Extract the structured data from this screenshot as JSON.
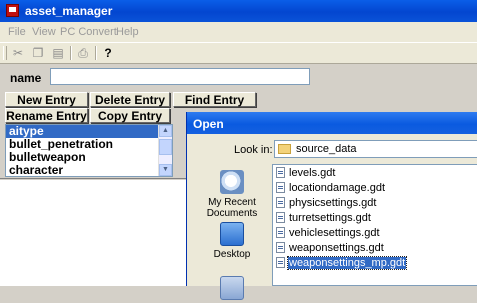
{
  "window": {
    "title": "asset_manager"
  },
  "menu": [
    "File",
    "View",
    "PC Convert",
    "Help"
  ],
  "toolbar": {
    "icons": [
      "cut-icon",
      "copy-icon",
      "paste-icon",
      "print-icon",
      "help-icon"
    ],
    "help_glyph": "?"
  },
  "form": {
    "name_label": "name",
    "name_value": ""
  },
  "buttons": {
    "new_entry": "New Entry",
    "delete_entry": "Delete Entry",
    "find_entry": "Find Entry",
    "rename_entry": "Rename Entry",
    "copy_entry": "Copy Entry"
  },
  "entries": {
    "items": [
      "aitype",
      "bullet_penetration",
      "bulletweapon",
      "character"
    ],
    "selected": "aitype"
  },
  "open_dialog": {
    "title": "Open",
    "look_in_label": "Look in:",
    "look_in_value": "source_data",
    "places": [
      "My Recent Documents",
      "Desktop"
    ],
    "files": [
      "levels.gdt",
      "locationdamage.gdt",
      "physicsettings.gdt",
      "turretsettings.gdt",
      "vehiclesettings.gdt",
      "weaponsettings.gdt",
      "weaponsettings_mp.gdt"
    ],
    "selected_file": "weaponsettings_mp.gdt"
  },
  "colors": {
    "titlebar": "#0a5ee8",
    "selection": "#316ac5",
    "face": "#ece9d8"
  }
}
